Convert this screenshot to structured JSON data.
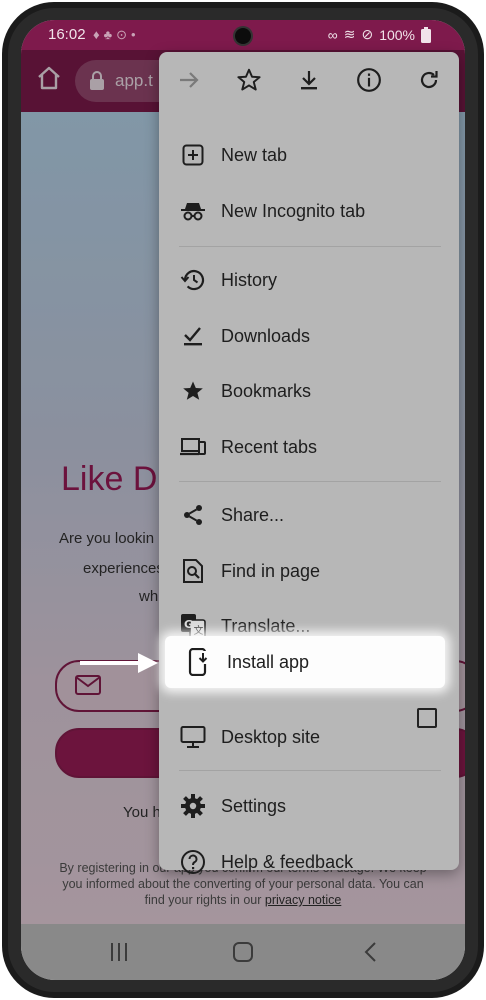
{
  "status_bar": {
    "time": "16:02",
    "battery": "100%"
  },
  "browser": {
    "url": "app.t"
  },
  "page": {
    "heading": "Like D",
    "intro_line1": "Are you lookin",
    "intro_line2": "experiences?",
    "intro_line3": "wh",
    "footer_you": "You h",
    "legal_line1": "By registering in our app you confirm our terms of usage. We keep",
    "legal_line2": "you informed about the converting of your personal data. You can",
    "legal_line3_prefix": "find your rights in our ",
    "legal_link": "privacy notice"
  },
  "menu": {
    "top_actions": [
      "forward-icon",
      "star-icon",
      "download-icon",
      "info-icon",
      "refresh-icon"
    ],
    "items": [
      {
        "label": "New tab",
        "icon": "new-tab-icon"
      },
      {
        "label": "New Incognito tab",
        "icon": "incognito-icon"
      },
      {
        "label": "History",
        "icon": "history-icon"
      },
      {
        "label": "Downloads",
        "icon": "downloads-icon"
      },
      {
        "label": "Bookmarks",
        "icon": "bookmark-star-icon"
      },
      {
        "label": "Recent tabs",
        "icon": "recent-tabs-icon"
      },
      {
        "label": "Share...",
        "icon": "share-icon"
      },
      {
        "label": "Find in page",
        "icon": "find-in-page-icon"
      },
      {
        "label": "Translate...",
        "icon": "translate-icon"
      },
      {
        "label": "Install app",
        "icon": "install-app-icon"
      },
      {
        "label": "Desktop site",
        "icon": "desktop-icon"
      },
      {
        "label": "Settings",
        "icon": "settings-icon"
      },
      {
        "label": "Help & feedback",
        "icon": "help-icon"
      }
    ],
    "desktop_site_checked": false
  },
  "colors": {
    "brand": "#7e1a4c",
    "accent": "#9b1b58",
    "menu_bg": "#b7b7b7",
    "highlight": "#ffffff"
  }
}
